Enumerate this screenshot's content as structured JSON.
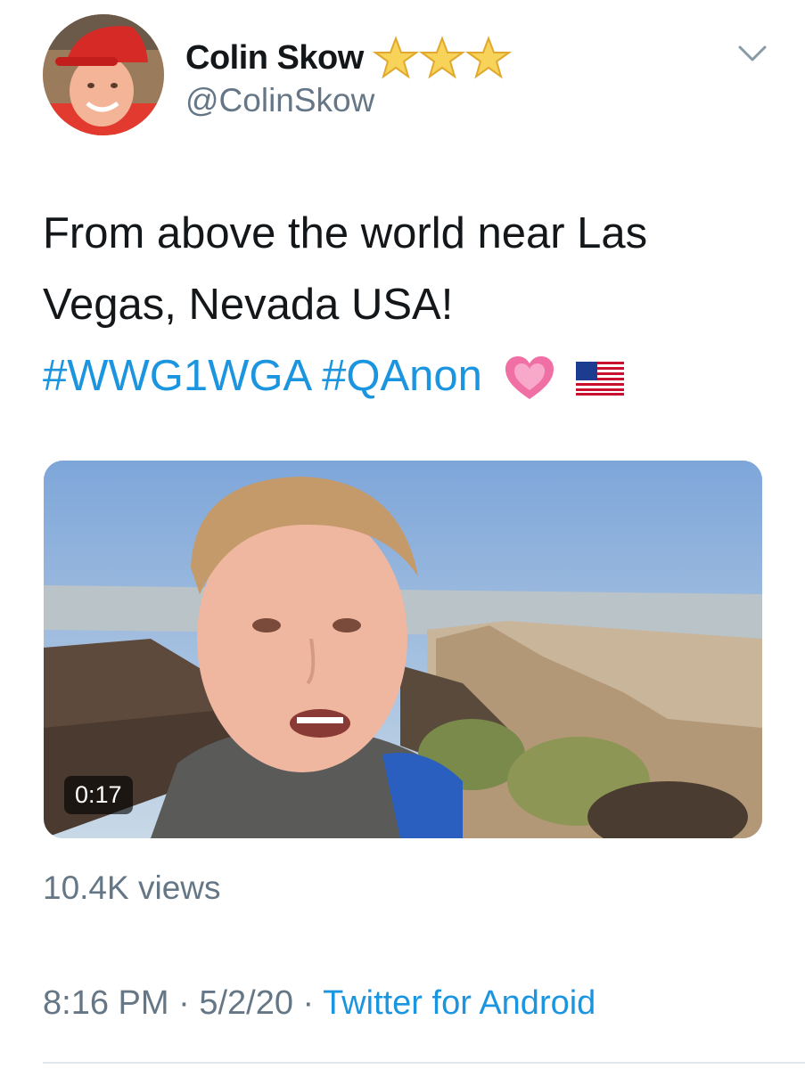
{
  "tweet": {
    "display_name": "Colin Skow",
    "name_badges": [
      "star-icon",
      "star-icon",
      "star-icon"
    ],
    "handle": "@ColinSkow",
    "text_line1": "From above the world near Las",
    "text_line2": "Vegas, Nevada USA!",
    "hashtags": [
      "#WWG1WGA",
      "#QAnon"
    ],
    "emojis": [
      "growing-heart-emoji",
      "us-flag-emoji"
    ],
    "video": {
      "duration": "0:17"
    },
    "views": "10.4K views",
    "time": "8:16 PM",
    "date": "5/2/20",
    "separator": "·",
    "source": "Twitter for Android"
  },
  "colors": {
    "link": "#1b95e0",
    "secondary_text": "#657786",
    "primary_text": "#14171a",
    "star": "#f5c518"
  }
}
